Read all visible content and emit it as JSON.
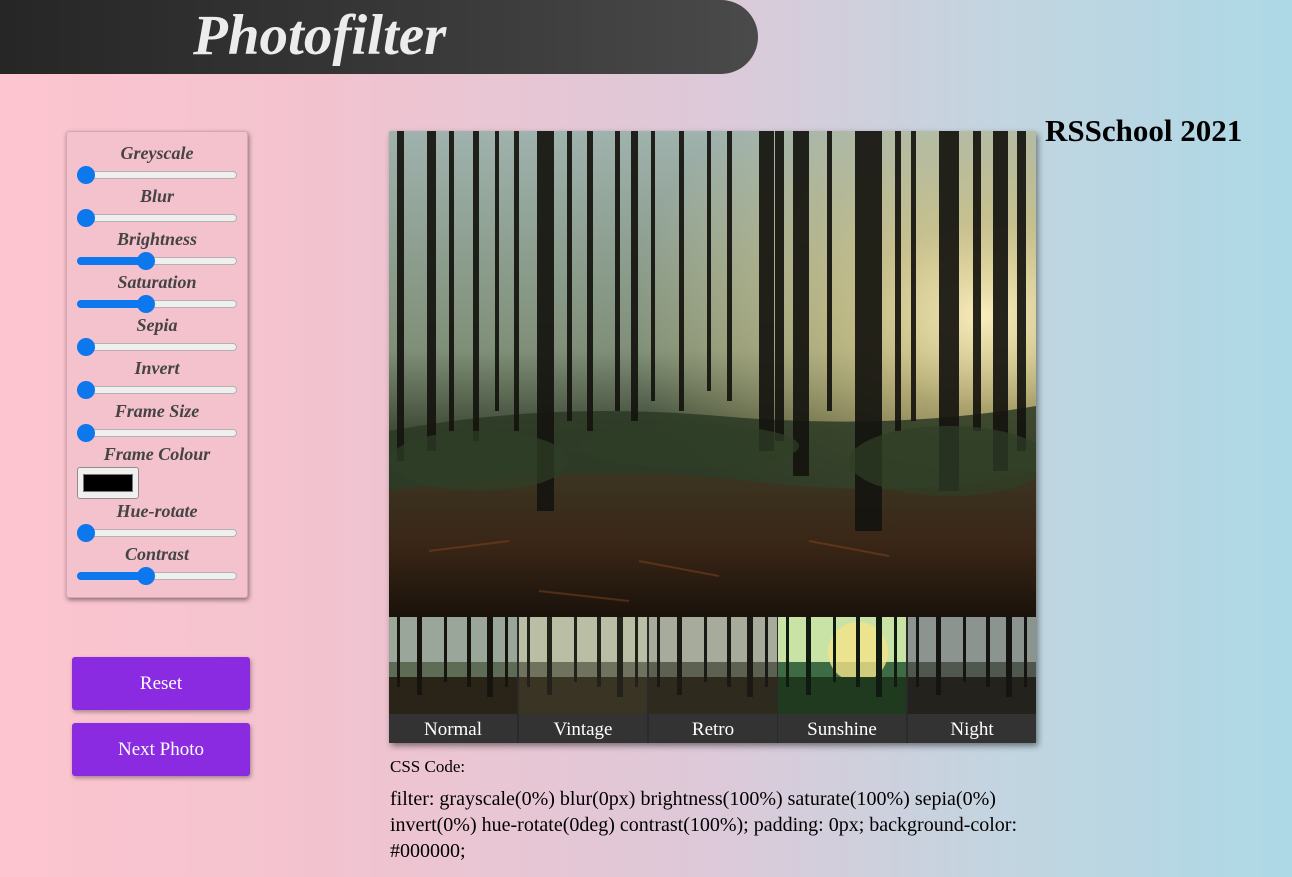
{
  "header": {
    "title": "Photofilter"
  },
  "brand": "RSSchool 2021",
  "controls": {
    "greyscale": {
      "label": "Greyscale",
      "value": 0
    },
    "blur": {
      "label": "Blur",
      "value": 0
    },
    "brightness": {
      "label": "Brightness",
      "value": 0.42
    },
    "saturation": {
      "label": "Saturation",
      "value": 0.42
    },
    "sepia": {
      "label": "Sepia",
      "value": 0
    },
    "invert": {
      "label": "Invert",
      "value": 0
    },
    "frame_size": {
      "label": "Frame Size",
      "value": 0
    },
    "frame_colour": {
      "label": "Frame Colour",
      "value": "#000000"
    },
    "hue_rotate": {
      "label": "Hue-rotate",
      "value": 0
    },
    "contrast": {
      "label": "Contrast",
      "value": 0.42
    }
  },
  "buttons": {
    "reset": "Reset",
    "next_photo": "Next Photo"
  },
  "presets": [
    {
      "label": "Normal"
    },
    {
      "label": "Vintage"
    },
    {
      "label": "Retro"
    },
    {
      "label": "Sunshine"
    },
    {
      "label": "Night"
    }
  ],
  "css_output": {
    "title": "CSS Code:",
    "code": "filter: grayscale(0%) blur(0px) brightness(100%) saturate(100%) sepia(0%) invert(0%) hue-rotate(0deg) contrast(100%); padding: 0px; background-color: #000000;"
  },
  "colors": {
    "accent": "#0d77ee",
    "button": "#8a2be2"
  }
}
